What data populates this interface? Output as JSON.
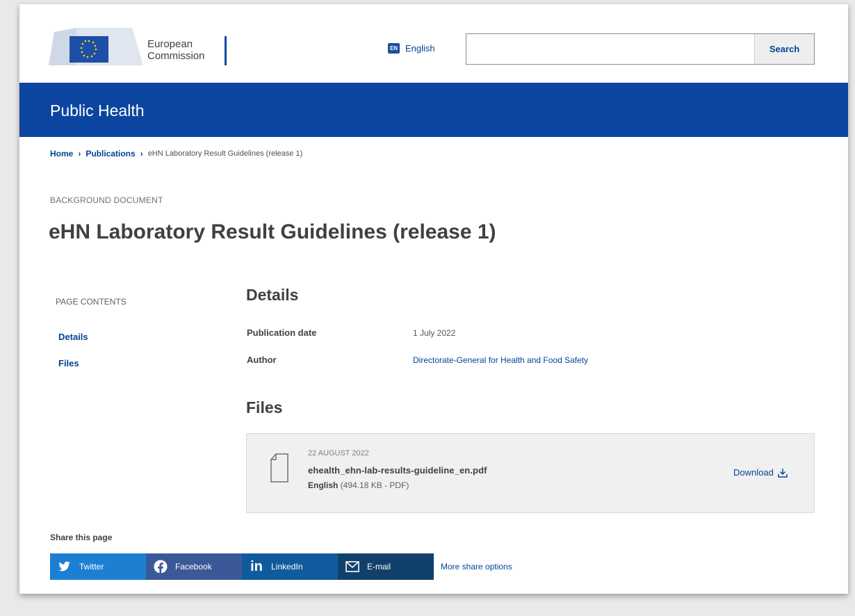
{
  "header": {
    "logo_line1": "European",
    "logo_line2": "Commission",
    "language_code": "EN",
    "language_label": "English",
    "search_placeholder": "",
    "search_button": "Search"
  },
  "banner": {
    "title": "Public Health"
  },
  "breadcrumb": {
    "items": [
      "Home",
      "Publications"
    ],
    "current": "eHN Laboratory Result Guidelines (release 1)"
  },
  "document": {
    "type": "BACKGROUND DOCUMENT",
    "title": "eHN Laboratory Result Guidelines (release 1)"
  },
  "toc": {
    "title": "PAGE CONTENTS",
    "items": [
      "Details",
      "Files"
    ]
  },
  "details": {
    "heading": "Details",
    "publication_date_label": "Publication date",
    "publication_date_value": "1 July 2022",
    "author_label": "Author",
    "author_value": "Directorate-General for Health and Food Safety"
  },
  "files": {
    "heading": "Files",
    "date": "22 AUGUST 2022",
    "filename": "ehealth_ehn-lab-results-guideline_en.pdf",
    "language": "English",
    "size": "(494.18 KB - PDF)",
    "download_label": "Download"
  },
  "share": {
    "title": "Share this page",
    "twitter": "Twitter",
    "facebook": "Facebook",
    "linkedin": "LinkedIn",
    "email": "E-mail",
    "more": "More share options"
  },
  "colors": {
    "brand_blue": "#0b45a0",
    "link_blue": "#004494"
  }
}
